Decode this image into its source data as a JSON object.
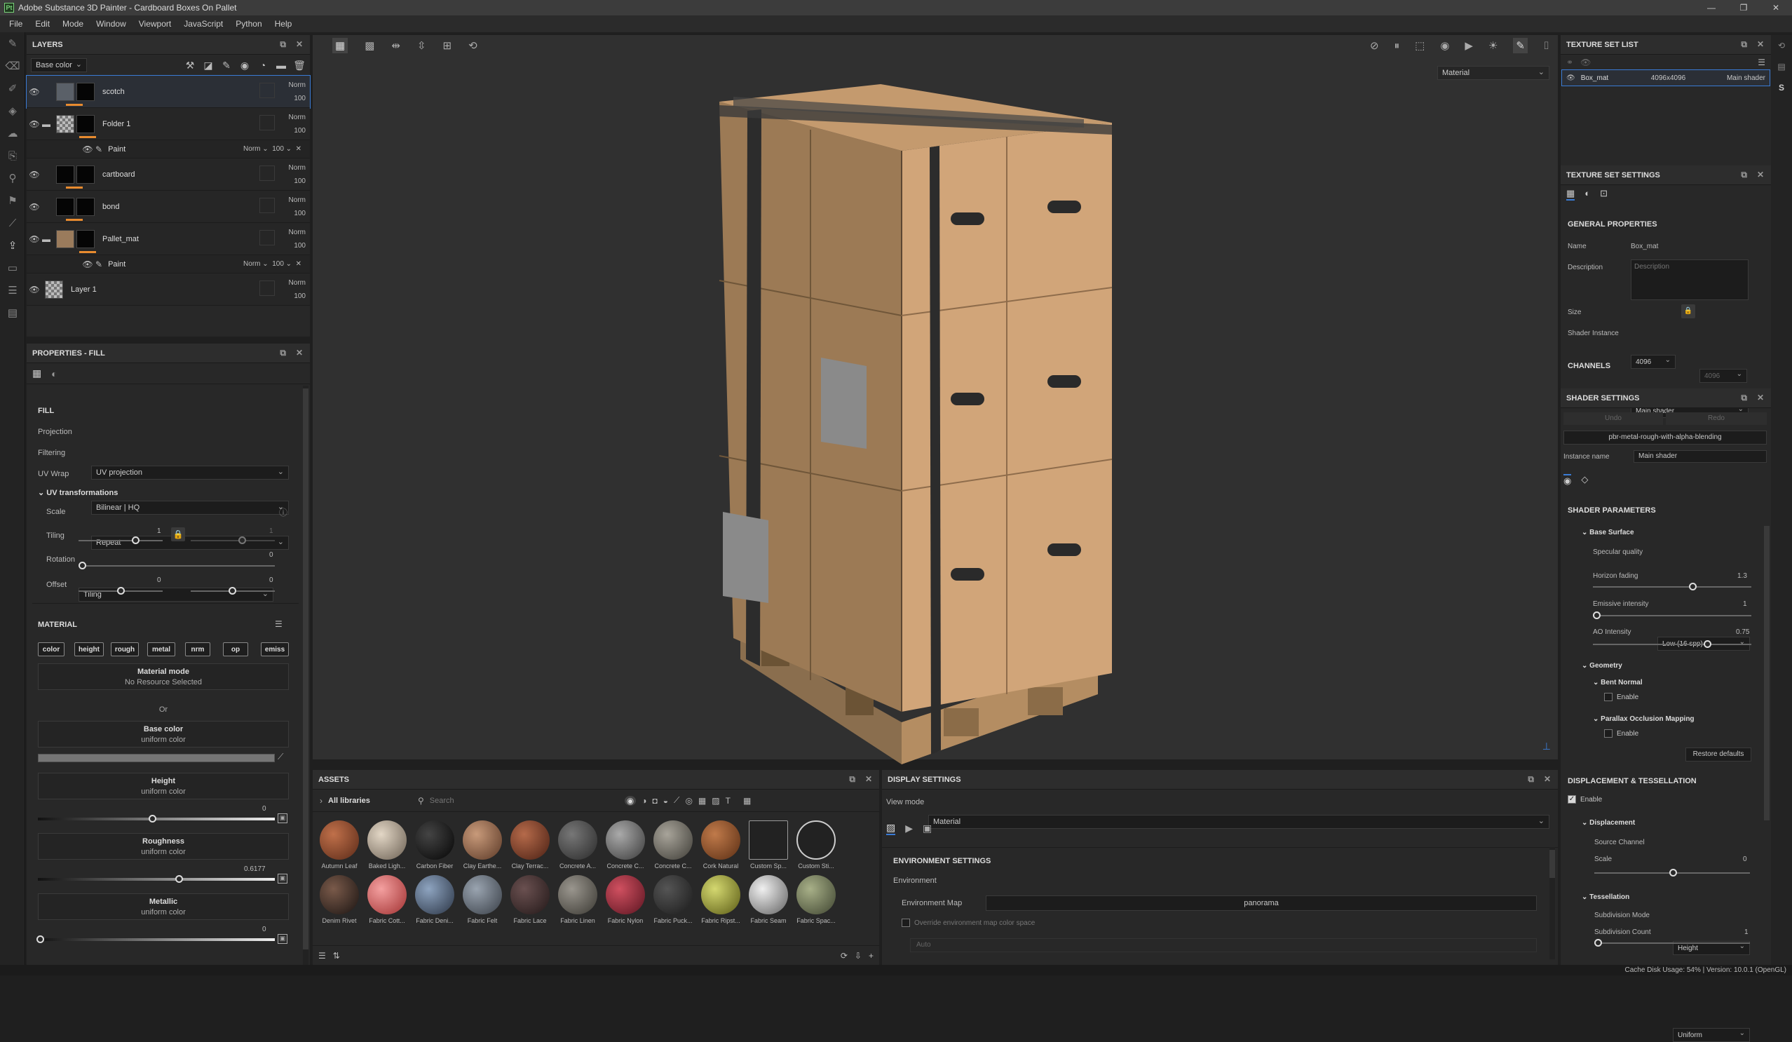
{
  "app": {
    "title": "Adobe Substance 3D Painter - Cardboard Boxes On Pallet",
    "logo": "Pt"
  },
  "menu": [
    "File",
    "Edit",
    "Mode",
    "Window",
    "Viewport",
    "JavaScript",
    "Python",
    "Help"
  ],
  "layers": {
    "title": "LAYERS",
    "channel": "Base color",
    "items": [
      {
        "name": "scotch",
        "blend": "Norm",
        "opacity": "100"
      },
      {
        "name": "Folder 1",
        "blend": "Norm",
        "opacity": "100"
      },
      {
        "name": "Paint",
        "blend": "Norm",
        "opacity": "100"
      },
      {
        "name": "cartboard",
        "blend": "Norm",
        "opacity": "100"
      },
      {
        "name": "bond",
        "blend": "Norm",
        "opacity": "100"
      },
      {
        "name": "Pallet_mat",
        "blend": "Norm",
        "opacity": "100"
      },
      {
        "name": "Paint",
        "blend": "Norm",
        "opacity": "100"
      },
      {
        "name": "Layer 1",
        "blend": "Norm",
        "opacity": "100"
      }
    ]
  },
  "properties": {
    "title": "PROPERTIES - FILL",
    "fill_section": "FILL",
    "projection_label": "Projection",
    "projection": "UV projection",
    "filtering_label": "Filtering",
    "filtering": "Bilinear | HQ",
    "uvwrap_label": "UV Wrap",
    "uvwrap": "Repeat",
    "uvtrans": "UV transformations",
    "scale_label": "Scale",
    "scale": "Tiling",
    "tiling_label": "Tiling",
    "tiling_value": "1",
    "tiling_value2": "1",
    "rotation_label": "Rotation",
    "rotation_value": "0",
    "offset_label": "Offset",
    "offset_x": "0",
    "offset_y": "0",
    "material_section": "MATERIAL",
    "chips": [
      "color",
      "height",
      "rough",
      "metal",
      "nrm",
      "op",
      "emiss"
    ],
    "material_mode": "Material mode",
    "no_resource": "No Resource Selected",
    "or": "Or",
    "base_color": "Base color",
    "uniform_color": "uniform color",
    "height": "Height",
    "height_value": "0",
    "roughness": "Roughness",
    "roughness_value": "0.6177",
    "metallic": "Metallic",
    "metallic_value": "0"
  },
  "viewport": {
    "mode": "Material"
  },
  "assets": {
    "title": "ASSETS",
    "library": "All libraries",
    "search_placeholder": "Search",
    "row1": [
      "Autumn Leaf",
      "Baked Ligh...",
      "Carbon Fiber",
      "Clay Earthe...",
      "Clay Terrac...",
      "Concrete A...",
      "Concrete C...",
      "Concrete C...",
      "Cork Natural",
      "Custom Sp...",
      "Custom Sti..."
    ],
    "row2": [
      "Denim Rivet",
      "Fabric Cott...",
      "Fabric Deni...",
      "Fabric Felt",
      "Fabric Lace",
      "Fabric Linen",
      "Fabric Nylon",
      "Fabric Puck...",
      "Fabric Ripst...",
      "Fabric Seam",
      "Fabric Spac..."
    ]
  },
  "display": {
    "title": "DISPLAY SETTINGS",
    "viewmode_label": "View mode",
    "viewmode": "Material",
    "env_section": "ENVIRONMENT SETTINGS",
    "environment": "Environment",
    "envmap_label": "Environment Map",
    "envmap": "panorama",
    "override": "Override environment map color space",
    "auto": "Auto"
  },
  "texture_set_list": {
    "title": "TEXTURE SET LIST",
    "name": "Box_mat",
    "size": "4096x4096",
    "shader": "Main shader"
  },
  "texture_set_settings": {
    "title": "TEXTURE SET SETTINGS",
    "general": "GENERAL PROPERTIES",
    "name_label": "Name",
    "name": "Box_mat",
    "desc_label": "Description",
    "desc_placeholder": "Description",
    "size_label": "Size",
    "size": "4096",
    "size2": "4096",
    "shader_label": "Shader Instance",
    "shader": "Main shader",
    "channels": "CHANNELS"
  },
  "shader_settings": {
    "title": "SHADER SETTINGS",
    "undo": "Undo",
    "redo": "Redo",
    "shader": "pbr-metal-rough-with-alpha-blending",
    "instance_label": "Instance name",
    "instance": "Main shader",
    "params": "SHADER PARAMETERS",
    "base_surface": "Base Surface",
    "specular_label": "Specular quality",
    "specular": "Low (16 spp)",
    "horizon_label": "Horizon fading",
    "horizon": "1.3",
    "emissive_label": "Emissive intensity",
    "emissive": "1",
    "ao_label": "AO Intensity",
    "ao": "0.75",
    "geometry": "Geometry",
    "bent_normal": "Bent Normal",
    "enable": "Enable",
    "pom": "Parallax Occlusion Mapping",
    "restore": "Restore defaults",
    "disp_tess": "DISPLACEMENT & TESSELLATION",
    "displacement": "Displacement",
    "source_label": "Source Channel",
    "source": "Height",
    "scale_label": "Scale",
    "scale": "0",
    "tessellation": "Tessellation",
    "subdiv_mode_label": "Subdivision Mode",
    "subdiv_mode": "Uniform",
    "subdiv_count_label": "Subdivision Count",
    "subdiv_count": "1"
  },
  "status": "Cache Disk Usage:  54% | Version: 10.0.1 (OpenGL)"
}
